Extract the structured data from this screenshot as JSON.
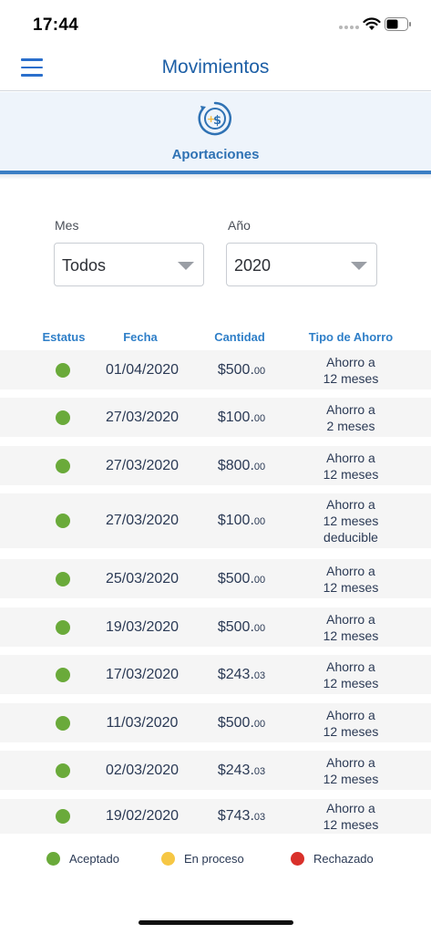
{
  "status_bar": {
    "time": "17:44"
  },
  "header": {
    "title": "Movimientos"
  },
  "section": {
    "title": "Aportaciones"
  },
  "filters": {
    "month": {
      "label": "Mes",
      "value": "Todos"
    },
    "year": {
      "label": "Año",
      "value": "2020"
    }
  },
  "table": {
    "columns": [
      "Estatus",
      "Fecha",
      "Cantidad",
      "Tipo de Ahorro"
    ],
    "rows": [
      {
        "status": "Aceptado",
        "date": "01/04/2020",
        "amount": "$500.",
        "cents": "00",
        "type": [
          "Ahorro a",
          "12 meses"
        ]
      },
      {
        "status": "Aceptado",
        "date": "27/03/2020",
        "amount": "$100.",
        "cents": "00",
        "type": [
          "Ahorro a",
          "2 meses"
        ]
      },
      {
        "status": "Aceptado",
        "date": "27/03/2020",
        "amount": "$800.",
        "cents": "00",
        "type": [
          "Ahorro a",
          "12 meses"
        ]
      },
      {
        "status": "Aceptado",
        "date": "27/03/2020",
        "amount": "$100.",
        "cents": "00",
        "type": [
          "Ahorro a",
          "12 meses",
          "deducible"
        ]
      },
      {
        "status": "Aceptado",
        "date": "25/03/2020",
        "amount": "$500.",
        "cents": "00",
        "type": [
          "Ahorro a",
          "12 meses"
        ]
      },
      {
        "status": "Aceptado",
        "date": "19/03/2020",
        "amount": "$500.",
        "cents": "00",
        "type": [
          "Ahorro a",
          "12 meses"
        ]
      },
      {
        "status": "Aceptado",
        "date": "17/03/2020",
        "amount": "$243.",
        "cents": "03",
        "type": [
          "Ahorro a",
          "12 meses"
        ]
      },
      {
        "status": "Aceptado",
        "date": "11/03/2020",
        "amount": "$500.",
        "cents": "00",
        "type": [
          "Ahorro a",
          "12 meses"
        ]
      },
      {
        "status": "Aceptado",
        "date": "02/03/2020",
        "amount": "$243.",
        "cents": "03",
        "type": [
          "Ahorro a",
          "12 meses"
        ]
      },
      {
        "status": "Aceptado",
        "date": "19/02/2020",
        "amount": "$743.",
        "cents": "03",
        "type": [
          "Ahorro a",
          "12 meses"
        ]
      }
    ]
  },
  "legend": [
    {
      "label": "Aceptado",
      "color": "#6aaa3a"
    },
    {
      "label": "En proceso",
      "color": "#f6c744"
    },
    {
      "label": "Rechazado",
      "color": "#d9302a"
    }
  ],
  "colors": {
    "primary": "#1d5fa6",
    "accent": "#2f7fc8",
    "accepted": "#6aaa3a"
  }
}
